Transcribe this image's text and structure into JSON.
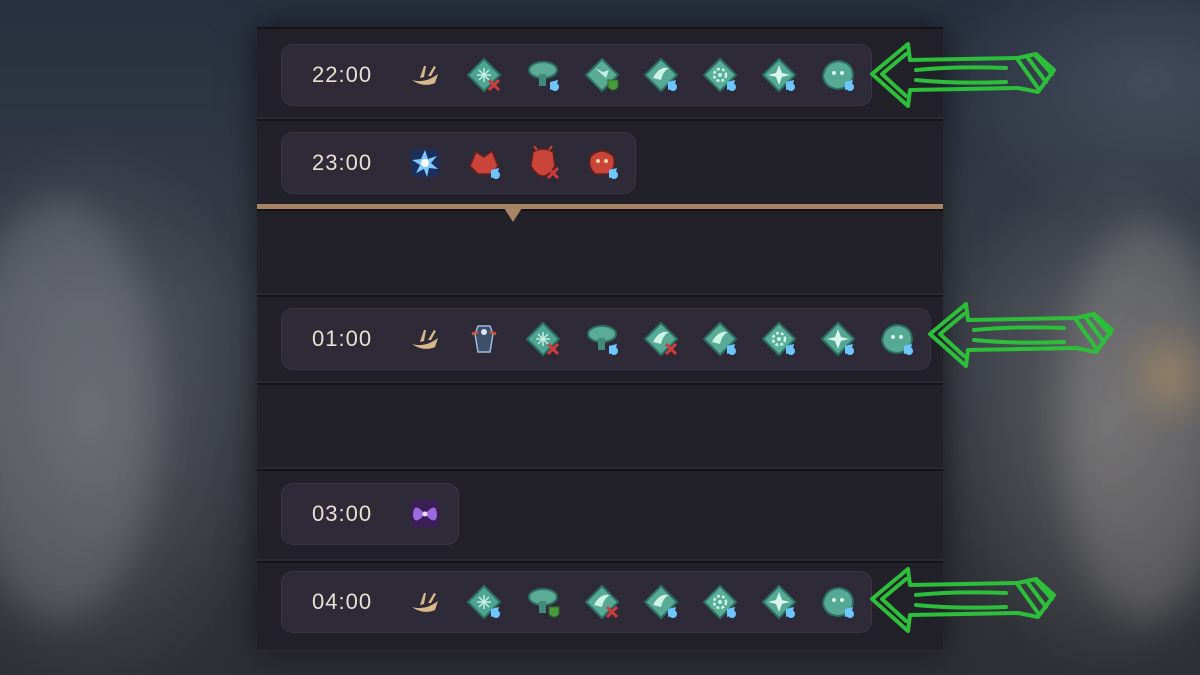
{
  "schedule": {
    "rows": [
      {
        "time": "22:00",
        "icons": [
          "ship-icon",
          "bloodstone-crossed-icon",
          "mushroom-tree-icon",
          "shield-emblem-icon",
          "wing-blue-icon",
          "gear-blue-icon",
          "star-blue-icon",
          "beast-blue-icon"
        ],
        "highlighted": true
      },
      {
        "time": "23:00",
        "icons": [
          "frost-burst-icon",
          "red-beast-blue-icon",
          "red-demon-crossed-icon",
          "red-creature-blue-icon"
        ],
        "highlighted": false
      },
      {
        "time": "01:00",
        "icons": [
          "ship-icon",
          "armored-figure-icon",
          "bloodstone-crossed-icon",
          "mushroom-tree-icon",
          "wing-crossed-icon",
          "wing-blue-icon",
          "gear-blue-icon",
          "star-blue-icon",
          "beast-blue-icon"
        ],
        "highlighted": true
      },
      {
        "time": "03:00",
        "icons": [
          "purple-butterfly-icon"
        ],
        "highlighted": false
      },
      {
        "time": "04:00",
        "icons": [
          "ship-icon",
          "bloodstone-blue-icon",
          "mushroom-tree-shield-icon",
          "wing-crossed-icon",
          "wing-blue-icon",
          "gear-blue-icon",
          "star-blue-icon",
          "beast-blue-icon"
        ],
        "highlighted": true
      }
    ]
  },
  "colors": {
    "panel_bg": "#1f1e27",
    "pill_bg": "#2e2a38",
    "divider": "#a88365",
    "teal": "#5fb3a1",
    "blue_accent": "#6ec6ff",
    "red_x": "#d23c3c",
    "red_enemy": "#c9453a",
    "arrow_green": "#2dbf3a",
    "ship_gold": "#d9b98a"
  }
}
